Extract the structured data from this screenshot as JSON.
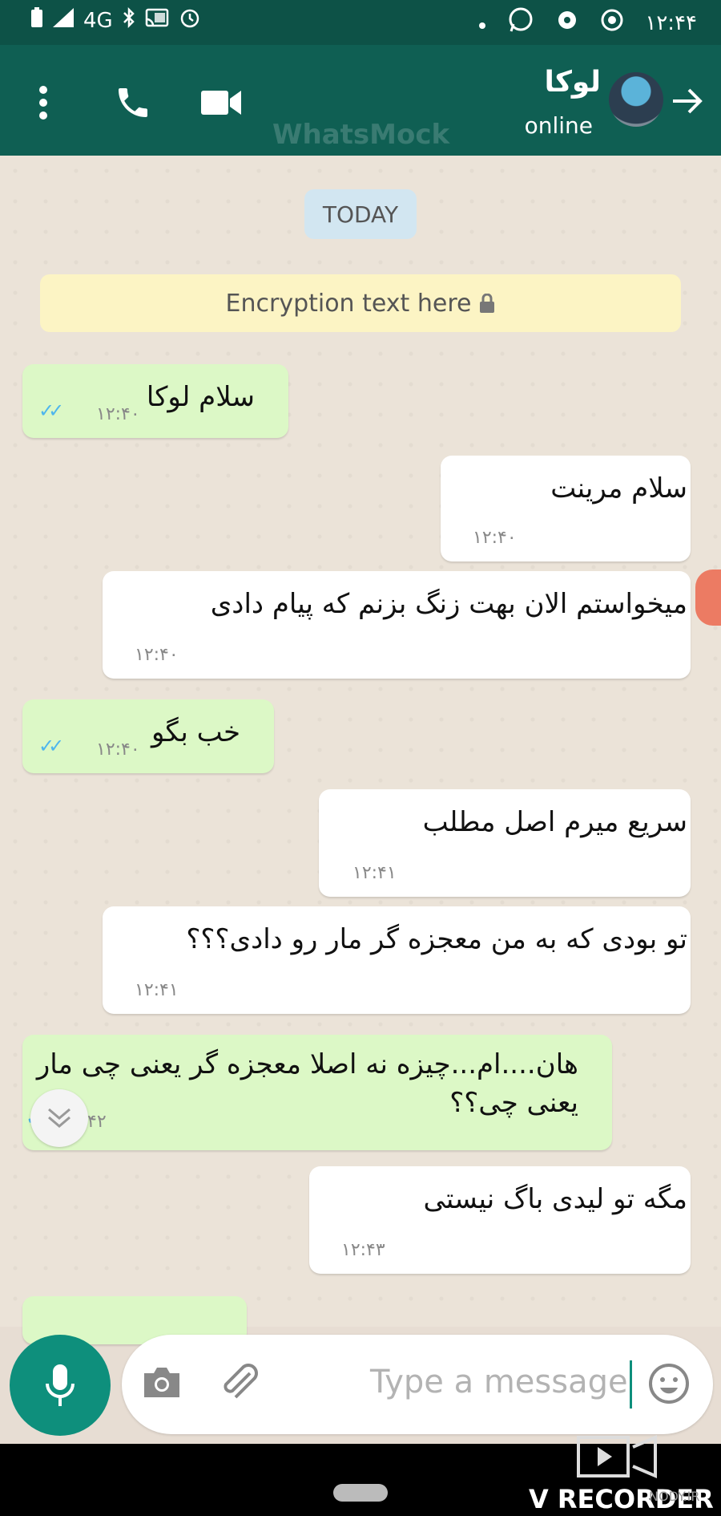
{
  "status_bar": {
    "network": "4G",
    "time": "۱۲:۴۴"
  },
  "header": {
    "watermark": "WhatsMock",
    "contact_name": "لوکا",
    "contact_status": "online"
  },
  "chat": {
    "day_label": "TODAY",
    "encryption_text": "Encryption text here",
    "messages": [
      {
        "direction": "out",
        "text": "سلام لوکا",
        "time": "۱۲:۴۰"
      },
      {
        "direction": "in",
        "text": "سلام مرینت",
        "time": "۱۲:۴۰"
      },
      {
        "direction": "in",
        "text": "میخواستم الان بهت زنگ بزنم که پیام دادی",
        "time": "۱۲:۴۰"
      },
      {
        "direction": "out",
        "text": "خب بگو",
        "time": "۱۲:۴۰"
      },
      {
        "direction": "in",
        "text": "سریع میرم اصل مطلب",
        "time": "۱۲:۴۱"
      },
      {
        "direction": "in",
        "text": "تو بودی که به من معجزه گر مار رو دادی؟؟؟",
        "time": "۱۲:۴۱"
      },
      {
        "direction": "out",
        "text_line1": "هان....ام...چیزه نه اصلا معجزه گر یعنی چی مار",
        "text_line2": "یعنی چی؟؟",
        "time": "۱۲:۴۲"
      },
      {
        "direction": "in",
        "text": "مگه تو لیدی باگ نیستی",
        "time": "۱۲:۴۳"
      }
    ]
  },
  "composer": {
    "placeholder": "Type a message"
  },
  "overlay": {
    "recorder_label": "V RECORDER",
    "site": "NODY.IR"
  },
  "colors": {
    "header": "#0f5f53",
    "outgoing_bubble": "#dcf8c6",
    "incoming_bubble": "#ffffff",
    "mic_button": "#0e8f7c",
    "read_ticks": "#4fb6ec"
  }
}
